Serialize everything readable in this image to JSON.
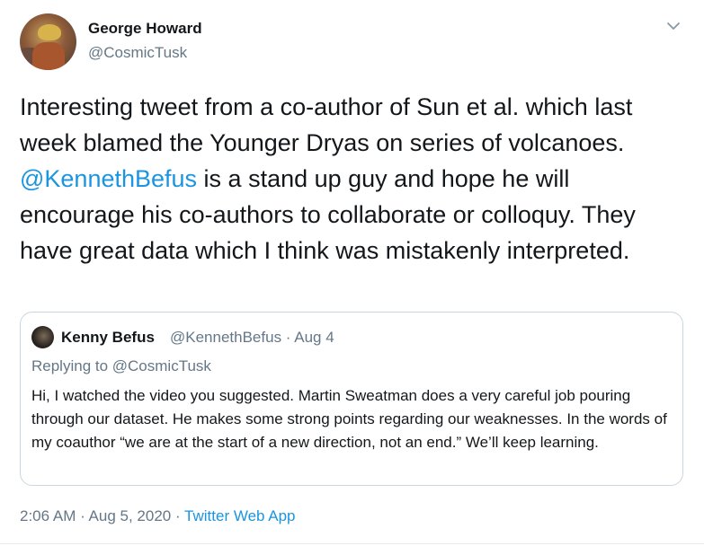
{
  "tweet": {
    "author": {
      "name": "George Howard",
      "handle": "@CosmicTusk"
    },
    "text": {
      "before_mention": "Interesting tweet from a co-author of Sun et al. which last week blamed the Younger Dryas on series of volcanoes. ",
      "mention": "@KennethBefus",
      "after_mention": " is a stand up guy and hope he will encourage his co-authors to collaborate or colloquy. They have great data which I think was mistakenly interpreted."
    },
    "quoted": {
      "name": "Kenny Befus",
      "meta": "@KennethBefus · Aug 4",
      "replying_to": "Replying to @CosmicTusk",
      "text": "Hi, I watched the video you suggested. Martin Sweatman does a very careful job pouring through our dataset. He makes some strong points regarding our weaknesses. In the words of my coauthor “we are at the start of a new direction, not an end.” We’ll keep learning."
    },
    "footer": {
      "timestamp": "2:06 AM · Aug 5, 2020 · ",
      "app": "Twitter Web App"
    },
    "icons": {
      "menu": "chevron-down-icon"
    },
    "colors": {
      "link": "#1b95e0",
      "secondary_text": "#657786",
      "border": "#ccd6dd"
    }
  }
}
